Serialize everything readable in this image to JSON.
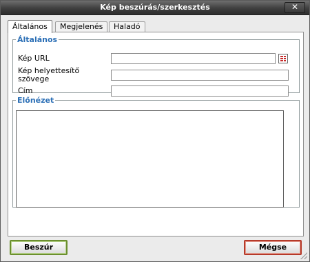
{
  "window": {
    "title": "Kép beszúrás/szerkesztés",
    "close_symbol": "✕"
  },
  "tabs": [
    {
      "label": "Általános",
      "active": true
    },
    {
      "label": "Megjelenés",
      "active": false
    },
    {
      "label": "Haladó",
      "active": false
    }
  ],
  "general": {
    "legend": "Általános",
    "fields": {
      "image_url": {
        "label": "Kép URL",
        "value": ""
      },
      "alt_text": {
        "label": "Kép helyettesítő szövege",
        "value": ""
      },
      "title": {
        "label": "Cím",
        "value": ""
      }
    },
    "browse_icon": "browse-icon"
  },
  "preview": {
    "legend": "Előnézet"
  },
  "buttons": {
    "insert": "Beszúr",
    "cancel": "Mégse"
  },
  "colors": {
    "legend": "#2b6fb6",
    "insert_border": "#6b8f2f",
    "cancel_border": "#b53a2a",
    "titlebar": "#3f3f3f"
  }
}
